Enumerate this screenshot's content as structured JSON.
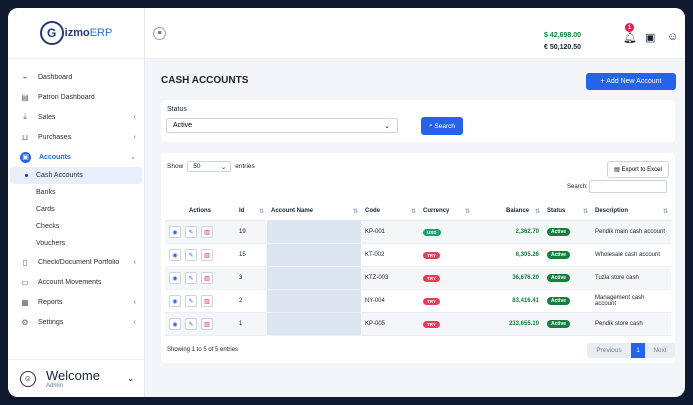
{
  "app": {
    "logo_prefix": "G",
    "logo_name": "izmo",
    "logo_suffix": "ERP"
  },
  "sidebar": {
    "items": [
      {
        "label": "Dashboard",
        "icon": "dashboard-icon"
      },
      {
        "label": "Patron Dashboard",
        "icon": "patron-icon"
      },
      {
        "label": "Sales",
        "icon": "sales-icon"
      },
      {
        "label": "Purchases",
        "icon": "purchases-icon"
      },
      {
        "label": "Accounts",
        "icon": "accounts-icon"
      }
    ],
    "sub_items": [
      "Cash Accounts",
      "Banks",
      "Cards",
      "Checks",
      "Vouchers"
    ],
    "items_after": [
      {
        "label": "Check/Document Portfolio",
        "icon": "portfolio-icon"
      },
      {
        "label": "Account Movements",
        "icon": "movements-icon"
      },
      {
        "label": "Reports",
        "icon": "reports-icon"
      },
      {
        "label": "Settings",
        "icon": "settings-icon"
      }
    ],
    "welcome_title": "Welcome",
    "welcome_user": "Admin"
  },
  "topbar": {
    "balance_usd": "$ 42,698.00",
    "balance_eur": "€ 50,120.50",
    "notification_count": "1"
  },
  "page": {
    "title": "CASH ACCOUNTS",
    "add_button": "+ Add New Account"
  },
  "filter": {
    "status_label": "Status",
    "status_value": "Active",
    "search_button": "Search"
  },
  "table_controls": {
    "show_label": "Show",
    "show_value": "50",
    "entries_label": "entries",
    "export_button": "Export to Excel",
    "search_label": "Search:"
  },
  "table": {
    "columns": [
      "Actions",
      "Id",
      "Account Name",
      "Code",
      "Currency",
      "Balance",
      "Status",
      "Description"
    ],
    "rows": [
      {
        "id": "19",
        "code": "KP-001",
        "currency": "USD",
        "balance": "2,362.70",
        "status": "Active",
        "description": "Pendik main cash account"
      },
      {
        "id": "15",
        "code": "KT-002",
        "currency": "TRY",
        "balance": "6,305.26",
        "status": "Active",
        "description": "Wholesale cash account"
      },
      {
        "id": "3",
        "code": "KTZ-003",
        "currency": "TRY",
        "balance": "36,676.20",
        "status": "Active",
        "description": "Tuzla store cash"
      },
      {
        "id": "2",
        "code": "NY-004",
        "currency": "TRY",
        "balance": "83,416.41",
        "status": "Active",
        "description": "Management cash account"
      },
      {
        "id": "1",
        "code": "KP-005",
        "currency": "TRY",
        "balance": "233,655.10",
        "status": "Active",
        "description": "Pendik store cash"
      }
    ]
  },
  "footer": {
    "showing": "Showing 1 to 5 of 5 entries",
    "previous": "Previous",
    "page": "1",
    "next": "Next"
  }
}
